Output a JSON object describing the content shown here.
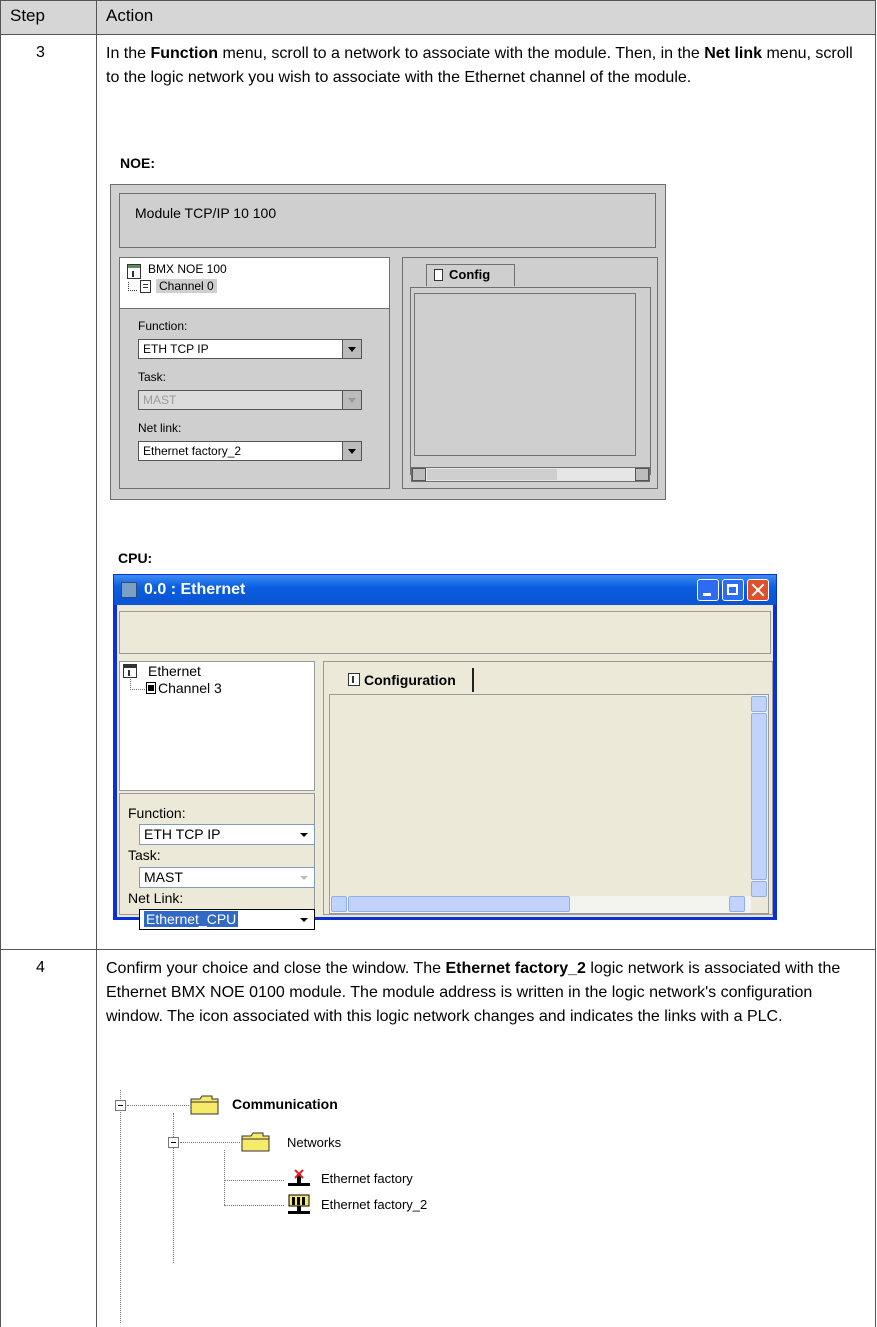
{
  "table": {
    "header": {
      "step": "Step",
      "action": "Action"
    },
    "rows": [
      {
        "step": "3"
      },
      {
        "step": "4"
      }
    ]
  },
  "step3": {
    "p1": "In the ",
    "b1": "Function",
    "p2": " menu, scroll to a network to associate with the module. Then, in the ",
    "b2": "Net link",
    "p3": " menu, scroll to the logic network you wish to associate with the Ethernet channel of the module."
  },
  "noe": {
    "caption": "NOE:",
    "title": "Module TCP/IP 10 100",
    "tree_module": "BMX NOE 100",
    "tree_channel": "Channel 0",
    "function_label": "Function:",
    "function_value": "ETH TCP IP",
    "task_label": "Task:",
    "task_value": "MAST",
    "netlink_label": "Net link:",
    "netlink_value": "Ethernet factory_2",
    "tab_label": "Config"
  },
  "cpu": {
    "caption": "CPU:",
    "window_title": "0.0 : Ethernet",
    "tree_root": "Ethernet",
    "tree_channel": "Channel 3",
    "function_label": "Function:",
    "function_value": "ETH TCP IP",
    "task_label": "Task:",
    "task_value": "MAST",
    "netlink_label": "Net Link:",
    "netlink_value": "Ethernet_CPU",
    "tab_label": "Configuration"
  },
  "step4": {
    "p1": "Confirm your choice and close the window. The ",
    "b1": "Ethernet factory_2",
    "p2": " logic network is associated with the Ethernet BMX NOE 0100 module. The module address is written in the logic network's configuration window. The icon associated with this logic network changes and indicates the links with a PLC."
  },
  "tree": {
    "communication": "Communication",
    "networks": "Networks",
    "net1": "Ethernet factory",
    "net2": "Ethernet factory_2"
  },
  "colors": {
    "header_bg": "#d6d6d6",
    "xp_title_blue": "#0a5fe0",
    "selection_blue": "#316ac5",
    "folder_yellow": "#f7e96a"
  }
}
